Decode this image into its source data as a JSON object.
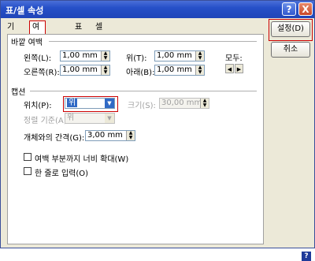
{
  "window": {
    "title": "표/셀 속성",
    "help_icon": "question-icon",
    "close_icon": "close-icon",
    "help_glyph": "?",
    "close_glyph": "X"
  },
  "tabs": [
    {
      "label": "기본"
    },
    {
      "label": "여백/캡션",
      "active": true
    },
    {
      "label": "표"
    },
    {
      "label": "셀"
    }
  ],
  "margins": {
    "group_label": "바깥 여백",
    "left_label": "왼쪽(L):",
    "left_value": "1,00 mm",
    "right_label": "오른쪽(R):",
    "right_value": "1,00 mm",
    "top_label": "위(T):",
    "top_value": "1,00 mm",
    "bottom_label": "아래(B):",
    "bottom_value": "1,00 mm",
    "all_label": "모두:"
  },
  "caption": {
    "group_label": "캡션",
    "position_label": "위치(P):",
    "position_value": "위",
    "size_label": "크기(S):",
    "size_value": "30,00 mm",
    "align_label": "정렬 기준(A):",
    "align_value": "위",
    "gap_label": "개체와의 간격(G):",
    "gap_value": "3,00 mm",
    "extend_label": "여백 부분까지 너비 확대(W)",
    "oneline_label": "한 줄로 입력(O)"
  },
  "buttons": {
    "ok": "설정(D)",
    "cancel": "취소"
  },
  "glyphs": {
    "up": "▲",
    "down": "▼",
    "left": "◀",
    "right": "▶",
    "help": "?"
  }
}
